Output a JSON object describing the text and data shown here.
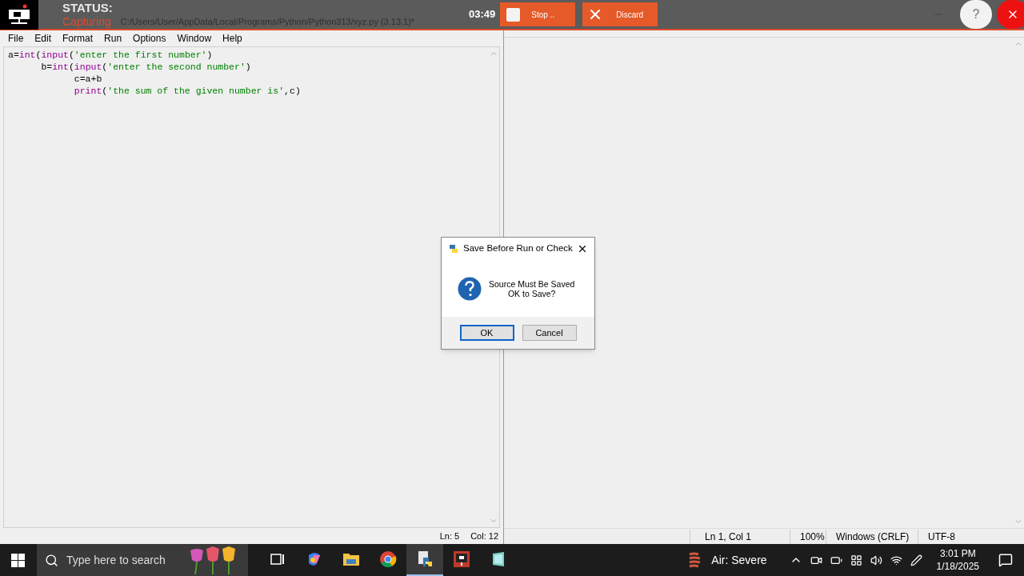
{
  "recorder": {
    "status_label": "STATUS:",
    "capturing": "Capturing",
    "timer": "03:49",
    "stop": "Stop ..",
    "discard": "Discard",
    "help": "?"
  },
  "editor": {
    "title": "C:/Users/User/AppData/Local/Programs/Python/Python313/xyz.py (3.13.1)*",
    "menu": [
      "File",
      "Edit",
      "Format",
      "Run",
      "Options",
      "Window",
      "Help"
    ],
    "code": [
      [
        {
          "kind": "plain",
          "text": "a="
        },
        {
          "kind": "builtin",
          "text": "int"
        },
        {
          "kind": "plain",
          "text": "("
        },
        {
          "kind": "builtin",
          "text": "input"
        },
        {
          "kind": "plain",
          "text": "("
        },
        {
          "kind": "string",
          "text": "'enter the first number'"
        },
        {
          "kind": "plain",
          "text": ")"
        }
      ],
      [
        {
          "kind": "plain",
          "text": "      b="
        },
        {
          "kind": "builtin",
          "text": "int"
        },
        {
          "kind": "plain",
          "text": "("
        },
        {
          "kind": "builtin",
          "text": "input"
        },
        {
          "kind": "plain",
          "text": "("
        },
        {
          "kind": "string",
          "text": "'enter the second number'"
        },
        {
          "kind": "plain",
          "text": ")"
        }
      ],
      [
        {
          "kind": "plain",
          "text": "            c=a+b"
        }
      ],
      [
        {
          "kind": "builtin",
          "text": "            print"
        },
        {
          "kind": "plain",
          "text": "("
        },
        {
          "kind": "string",
          "text": "'the sum of the given number is'"
        },
        {
          "kind": "plain",
          "text": ",c)"
        }
      ]
    ],
    "status": [
      "Ln: 5",
      "Col: 12"
    ]
  },
  "notepad": {
    "status": [
      "Ln 1, Col 1",
      "100%",
      "Windows (CRLF)",
      "UTF-8"
    ]
  },
  "dialog": {
    "title": "Save Before Run or Check",
    "message": [
      "Source Must Be Saved",
      "OK to Save?"
    ],
    "buttons": [
      {
        "label": "OK",
        "selected": true
      },
      {
        "label": "Cancel",
        "selected": false
      }
    ]
  },
  "taskbar": {
    "search_placeholder": "Type here to search",
    "weather": "Air: Severe",
    "time": "3:01 PM",
    "date": "1/18/2025",
    "apps": [
      {
        "kind": "taskview",
        "active": false
      },
      {
        "kind": "copilot",
        "active": false
      },
      {
        "kind": "folder",
        "active": false
      },
      {
        "kind": "chrome",
        "active": false
      },
      {
        "kind": "python",
        "active": true
      },
      {
        "kind": "recorder",
        "active": false
      },
      {
        "kind": "notepad",
        "active": false
      }
    ]
  }
}
